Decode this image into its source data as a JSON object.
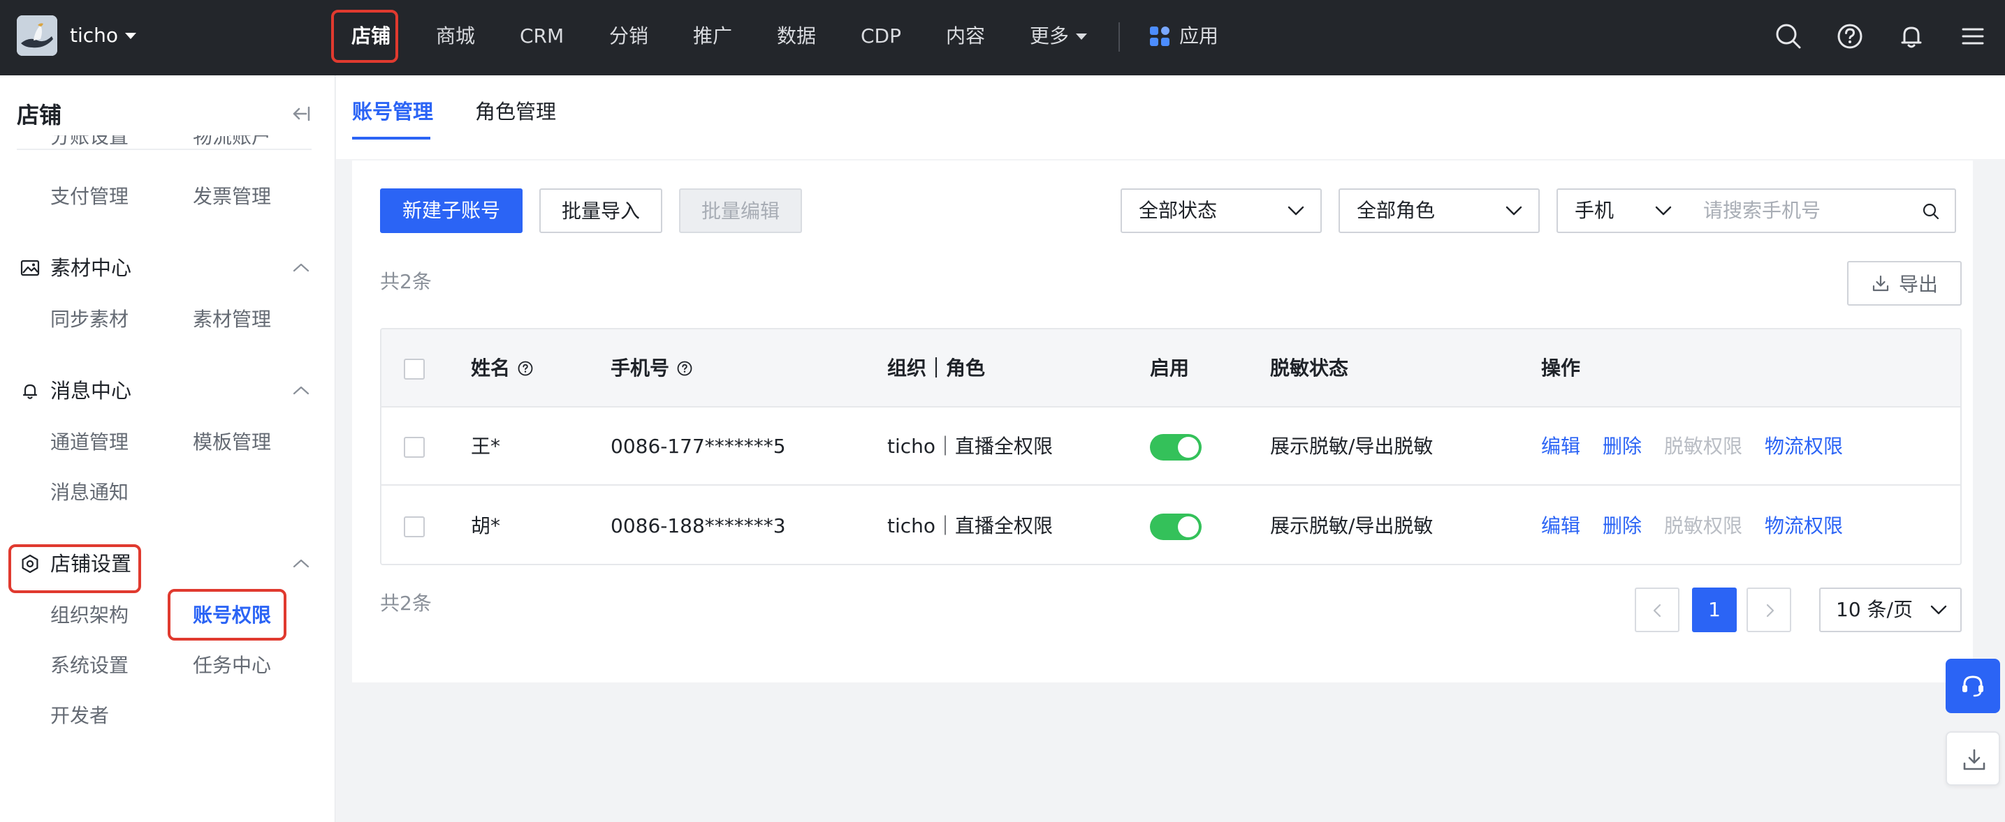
{
  "topbar": {
    "brand": "ticho",
    "nav": [
      "店铺",
      "商城",
      "CRM",
      "分销",
      "推广",
      "数据",
      "CDP",
      "内容",
      "更多"
    ],
    "apps_label": "应用",
    "icons": [
      "search-icon",
      "help-icon",
      "bell-icon",
      "menu-icon"
    ]
  },
  "sidebar": {
    "title": "店铺",
    "clipped_items": [
      "分账设置",
      "物流账户"
    ],
    "groups": [
      {
        "label": "素材中心",
        "icon": "image-icon",
        "items": [
          "同步素材",
          "素材管理"
        ]
      },
      {
        "label": "消息中心",
        "icon": "bell-icon",
        "items": [
          "通道管理",
          "模板管理",
          "消息通知"
        ]
      },
      {
        "label": "店铺设置",
        "icon": "hexagon-settings-icon",
        "items": [
          "组织架构",
          "账号权限",
          "系统设置",
          "任务中心",
          "开发者"
        ]
      }
    ],
    "payment_items": [
      "支付管理",
      "发票管理"
    ],
    "active_item": "账号权限"
  },
  "tabs": [
    "账号管理",
    "角色管理"
  ],
  "toolbar": {
    "new_account": "新建子账号",
    "batch_import": "批量导入",
    "batch_edit": "批量编辑",
    "status_filter": "全部状态",
    "role_filter": "全部角色",
    "search_type": "手机",
    "search_placeholder": "请搜索手机号"
  },
  "count_label": "共2条",
  "export_label": "导出",
  "table": {
    "columns": [
      "姓名",
      "手机号",
      "组织｜角色",
      "启用",
      "脱敏状态",
      "操作"
    ],
    "rows": [
      {
        "name": "王*",
        "phone": "0086-177*******5",
        "org_role": "ticho｜直播全权限",
        "enabled": true,
        "desensitize": "展示脱敏/导出脱敏"
      },
      {
        "name": "胡*",
        "phone": "0086-188*******3",
        "org_role": "ticho｜直播全权限",
        "enabled": true,
        "desensitize": "展示脱敏/导出脱敏"
      }
    ],
    "actions": [
      "编辑",
      "删除",
      "脱敏权限",
      "物流权限"
    ]
  },
  "pagination": {
    "current": "1",
    "page_size": "10 条/页"
  },
  "colors": {
    "primary": "#2b64f5",
    "topbar": "#23262b",
    "toggle_on": "#34c15a",
    "highlight": "#e03a2f"
  }
}
